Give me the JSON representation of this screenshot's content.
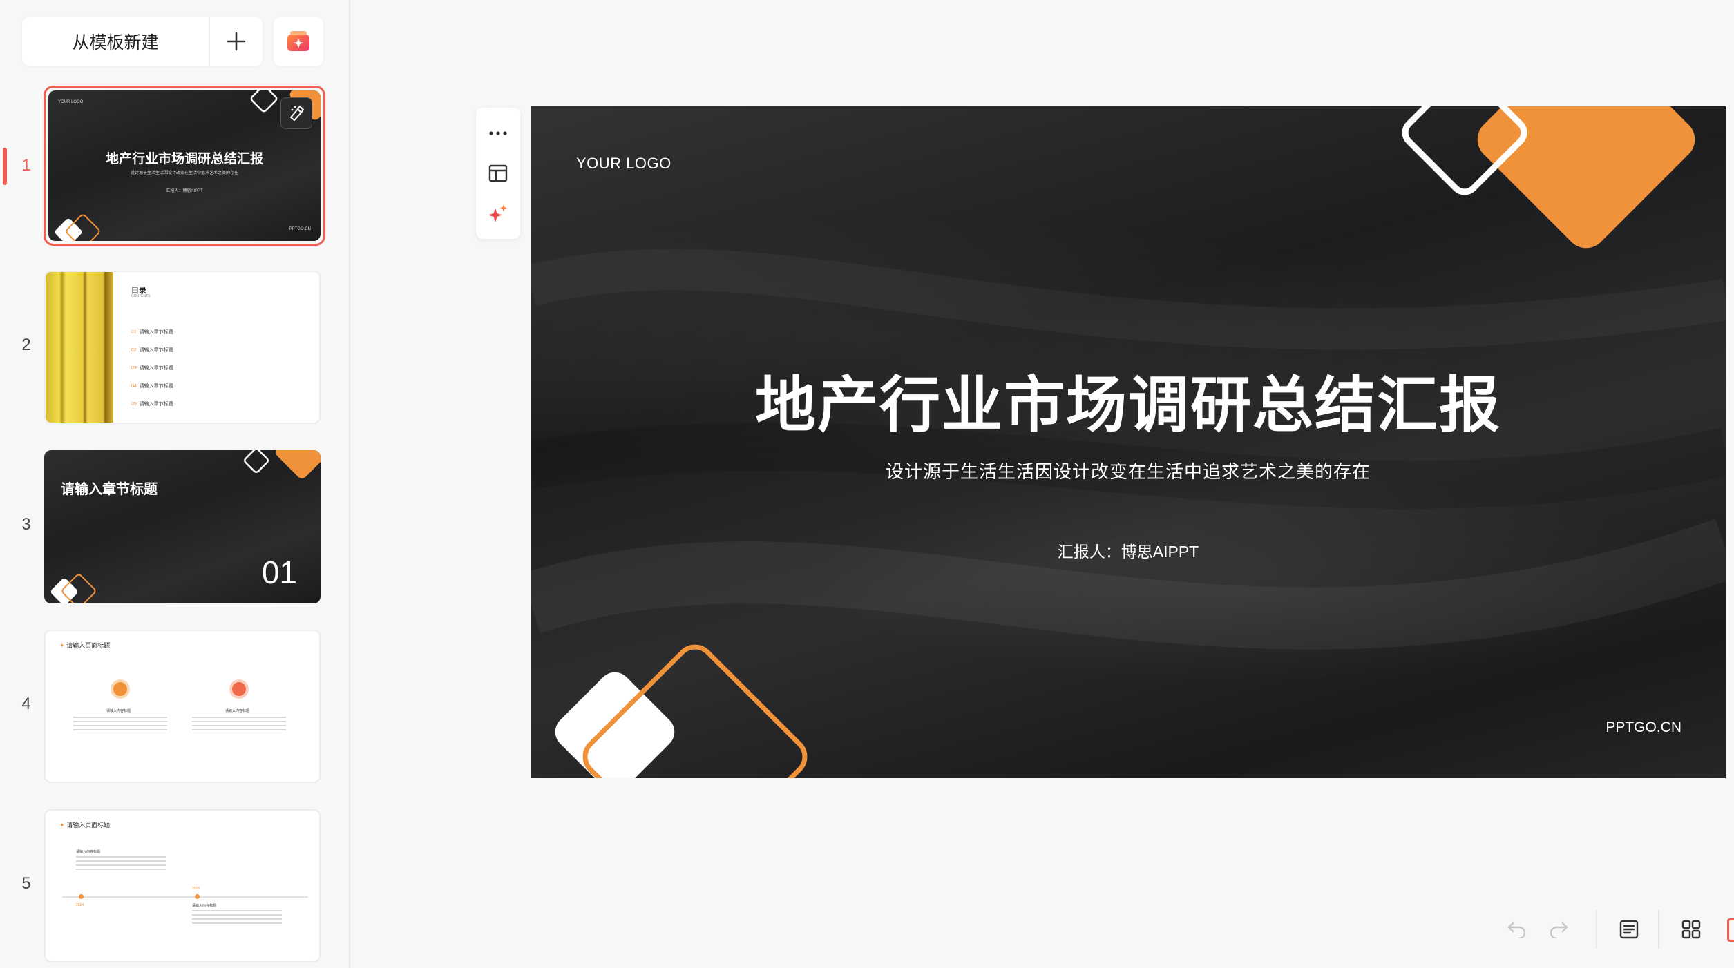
{
  "sidebar": {
    "new_from_template": "从模板新建",
    "add_icon": "plus-icon",
    "ai_icon": "ai-sparkle-icon"
  },
  "thumbnails": [
    {
      "number": "1",
      "logo": "YOUR LOGO",
      "title": "地产行业市场调研总结汇报",
      "subtitle": "设计源于生活生活因设计改变在生活中追求艺术之美的存在",
      "reporter": "汇报人：博思AIPPT",
      "site": "PPTGO.CN"
    },
    {
      "number": "2",
      "title": "目录",
      "subtitle": "CONTENTS",
      "items": [
        {
          "no": "01",
          "text": "请输入章节标题"
        },
        {
          "no": "02",
          "text": "请输入章节标题"
        },
        {
          "no": "03",
          "text": "请输入章节标题"
        },
        {
          "no": "04",
          "text": "请输入章节标题"
        },
        {
          "no": "05",
          "text": "请输入章节标题"
        }
      ]
    },
    {
      "number": "3",
      "title": "请输入章节标题",
      "chapter_no": "01"
    },
    {
      "number": "4",
      "title": "请输入页面标题",
      "col_title": "请输入内容标题"
    },
    {
      "number": "5",
      "title": "请输入页面标题",
      "col_title": "请输入内容标题",
      "year_a": "2024",
      "year_b": "2026"
    }
  ],
  "slide": {
    "logo": "YOUR LOGO",
    "title": "地产行业市场调研总结汇报",
    "subtitle": "设计源于生活生活因设计改变在生活中追求艺术之美的存在",
    "reporter": "汇报人：博思AIPPT",
    "site": "PPTGO.CN"
  },
  "colors": {
    "accent": "#ef5e50",
    "orange": "#f0923a",
    "slide_dark": "#222224"
  }
}
